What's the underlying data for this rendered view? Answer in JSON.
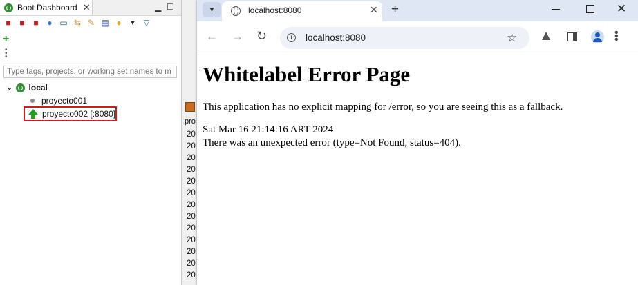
{
  "ide": {
    "view_title": "Boot Dashboard",
    "filter_placeholder": "Type tags, projects, or working set names to m",
    "tree": {
      "target": "local",
      "projects": [
        {
          "name": "proyecto001",
          "status": "stopped"
        },
        {
          "name": "proyecto002 [:8080]",
          "status": "running"
        }
      ]
    },
    "console": {
      "label": "pro",
      "lines": [
        "20",
        "20",
        "20",
        "20",
        "20",
        "20",
        "20",
        "20",
        "20",
        "20",
        "20",
        "20",
        "20"
      ]
    },
    "toolbar_icons": [
      "start-debug-icon",
      "restart-icon",
      "stop-icon",
      "globe-icon",
      "console-icon",
      "link-icon",
      "pencil-icon",
      "properties-icon",
      "bulb-icon",
      "dropdown-icon",
      "filter-icon"
    ],
    "highlight_color": "#d11a1a"
  },
  "browser": {
    "tab_title": "localhost:8080",
    "url": "localhost:8080",
    "content": {
      "title": "Whitelabel Error Page",
      "description": "This application has no explicit mapping for /error, so you are seeing this as a fallback.",
      "timestamp": "Sat Mar 16 21:14:16 ART 2024",
      "status_text": "There was an unexpected error (type=Not Found, status=404)."
    }
  }
}
